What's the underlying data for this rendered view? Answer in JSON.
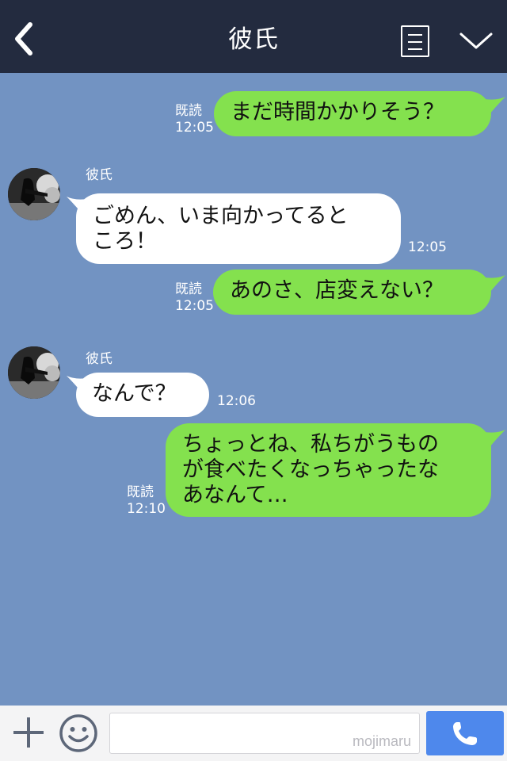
{
  "header": {
    "title": "彼氏"
  },
  "icons": {
    "back": "back-arrow-icon",
    "menu": "menu-list-icon",
    "collapse": "chevron-down-icon",
    "plus": "plus-icon",
    "emoji": "emoji-icon",
    "call": "phone-icon"
  },
  "messages": [
    {
      "from": "me",
      "text": "まだ時間かかりそう？",
      "read": "既読",
      "time": "12:05"
    },
    {
      "from": "them",
      "name": "彼氏",
      "line1": "ごめん、いま向かってると",
      "line2": "ころ！",
      "time": "12:05"
    },
    {
      "from": "me",
      "text": "あのさ、店変えない？",
      "read": "既読",
      "time": "12:05"
    },
    {
      "from": "them",
      "name": "彼氏",
      "text": "なんで？",
      "time": "12:06"
    },
    {
      "from": "me",
      "line1": "ちょっとね、私ちがうもの",
      "line2": "が食べたくなっちゃったな",
      "line3": "あなんて…",
      "read": "既読",
      "time": "12:10"
    }
  ],
  "input": {
    "watermark": "mojimaru"
  },
  "colors": {
    "background": "#7293c2",
    "header": "#232b3f",
    "my_bubble": "#84e14e",
    "their_bubble": "#ffffff",
    "call_button": "#4e88ec"
  }
}
